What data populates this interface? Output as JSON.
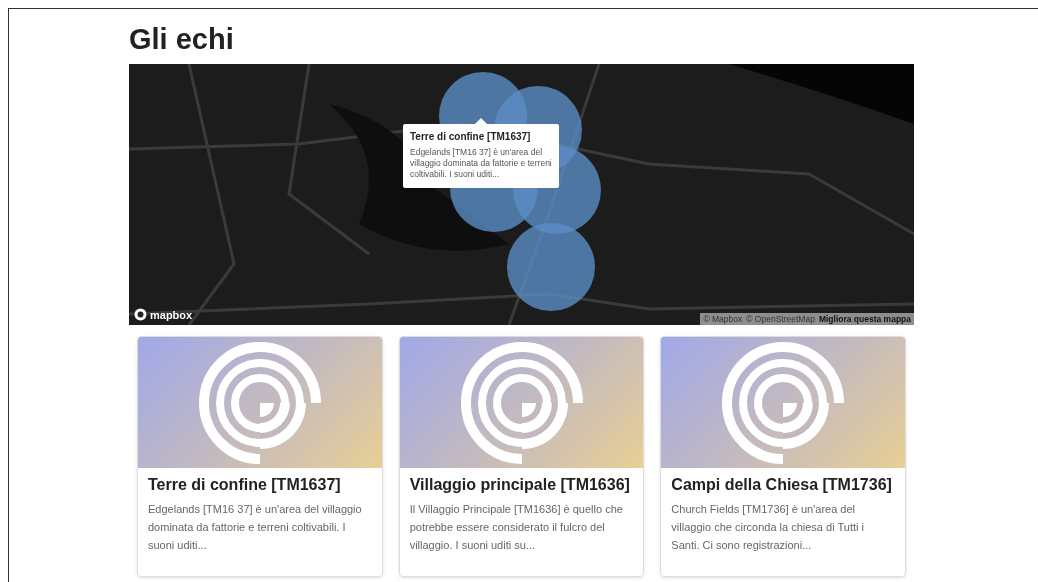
{
  "page": {
    "title": "Gli echi"
  },
  "map": {
    "popup": {
      "title": "Terre di confine [TM1637]",
      "text": "Edgelands [TM16 37] è un'area del villaggio dominata da fattorie e terreni coltivabili. I suoni uditi..."
    },
    "logo": "mapbox",
    "attribution": [
      "© Mapbox",
      "© OpenStreetMap"
    ],
    "improve_link": "Migliora questa mappa"
  },
  "cards": [
    {
      "title": "Terre di confine [TM1637]",
      "text": "Edgelands [TM16 37] è un'area del villaggio dominata da fattorie e terreni coltivabili. I suoni uditi..."
    },
    {
      "title": "Villaggio principale [TM1636]",
      "text": "Il Villaggio Principale [TM1636] è quello che potrebbe essere considerato il fulcro del villaggio. I suoni uditi su..."
    },
    {
      "title": "Campi della Chiesa [TM1736]",
      "text": "Church Fields [TM1736] è un'area del villaggio che circonda la chiesa di Tutti i Santi. Ci sono registrazioni..."
    }
  ]
}
